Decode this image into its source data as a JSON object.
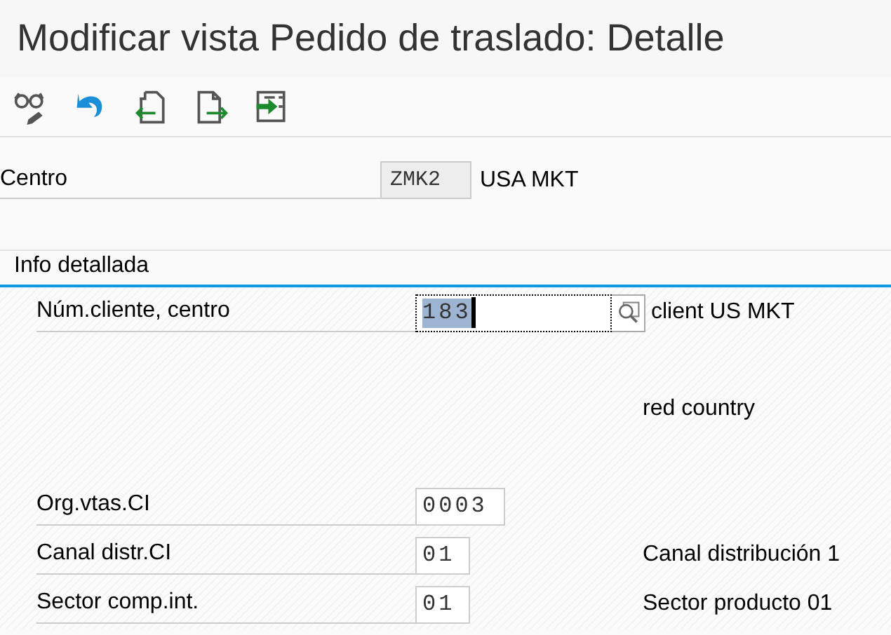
{
  "window": {
    "title": "Modificar vista Pedido de traslado: Detalle"
  },
  "toolbar": [
    {
      "kind": "display"
    },
    {
      "kind": "undo"
    },
    {
      "kind": "previous"
    },
    {
      "kind": "next"
    },
    {
      "kind": "expand"
    }
  ],
  "header": {
    "label": "Centro",
    "value": "ZMK2",
    "description": "USA MKT"
  },
  "detail": {
    "title": "Info detallada",
    "rows": [
      {
        "label": "Núm.cliente, centro",
        "value": "183",
        "focused": true,
        "search": true,
        "description": "client US MKT"
      },
      {
        "description": "red country"
      },
      {
        "label": "Org.vtas.CI",
        "value": "0003"
      },
      {
        "label": "Canal distr.CI",
        "value": "01",
        "description": "Canal distribución 1"
      },
      {
        "label": "Sector comp.int.",
        "value": "01",
        "description": "Sector producto 01"
      }
    ]
  }
}
